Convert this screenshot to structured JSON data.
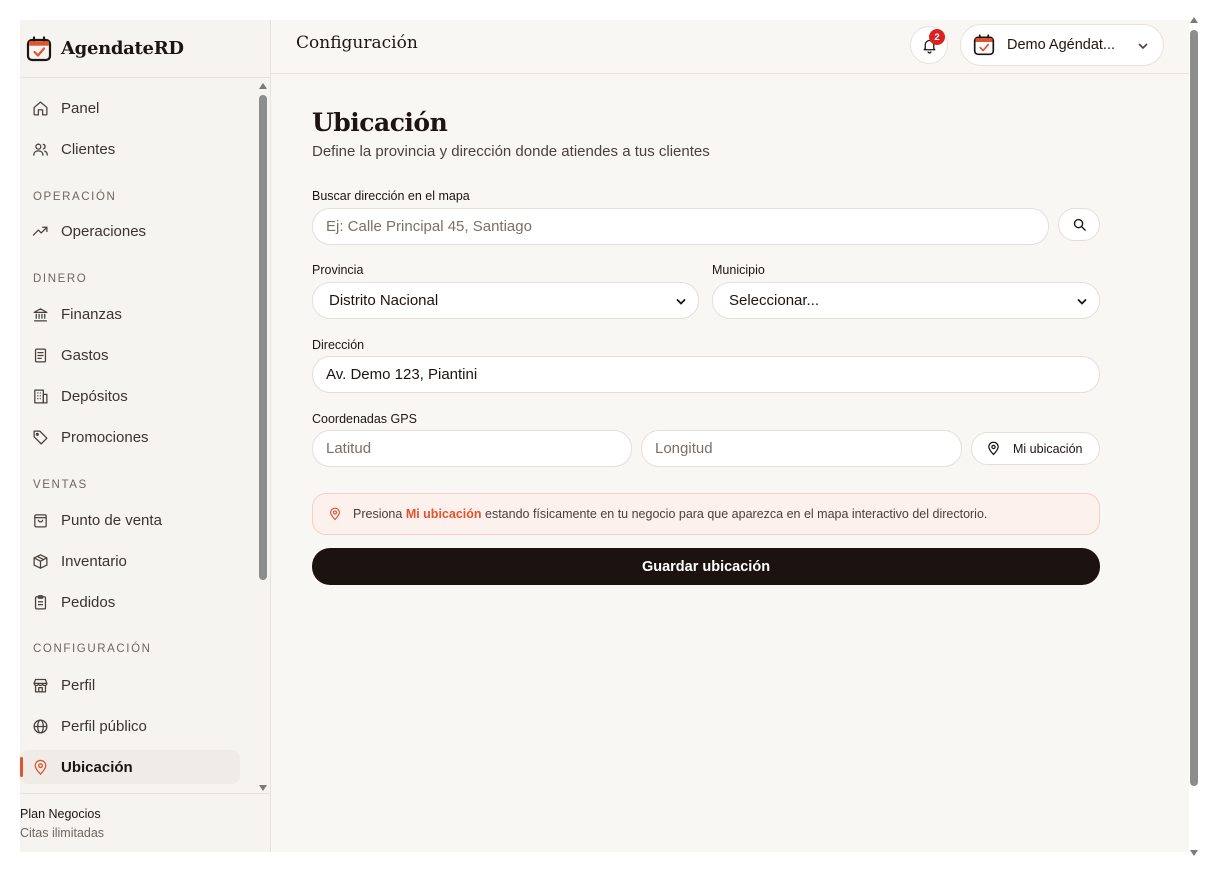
{
  "brand": {
    "name": "AgendateRD"
  },
  "sidebar": {
    "items": [
      {
        "label": "Panel",
        "icon": "home-icon"
      },
      {
        "label": "Clientes",
        "icon": "users-icon"
      },
      {
        "section": "OPERACIÓN"
      },
      {
        "label": "Operaciones",
        "icon": "trend-icon"
      },
      {
        "section": "DINERO"
      },
      {
        "label": "Finanzas",
        "icon": "bank-icon"
      },
      {
        "label": "Gastos",
        "icon": "receipt-icon"
      },
      {
        "label": "Depósitos",
        "icon": "building-icon"
      },
      {
        "label": "Promociones",
        "icon": "tag-icon"
      },
      {
        "section": "VENTAS"
      },
      {
        "label": "Punto de venta",
        "icon": "bag-icon"
      },
      {
        "label": "Inventario",
        "icon": "box-icon"
      },
      {
        "label": "Pedidos",
        "icon": "clipboard-icon"
      },
      {
        "section": "CONFIGURACIÓN"
      },
      {
        "label": "Perfil",
        "icon": "store-icon"
      },
      {
        "label": "Perfil público",
        "icon": "globe-icon"
      },
      {
        "label": "Ubicación",
        "icon": "map-pin-icon",
        "active": true
      }
    ],
    "plan": {
      "name": "Plan Negocios",
      "detail": "Citas ilimitadas"
    }
  },
  "header": {
    "title": "Configuración",
    "notifications_count": "2",
    "account_name": "Demo Agéndat..."
  },
  "main": {
    "title": "Ubicación",
    "subtitle": "Define la provincia y dirección donde atiendes a tus clientes",
    "search": {
      "label": "Buscar dirección en el mapa",
      "placeholder": "Ej: Calle Principal 45, Santiago"
    },
    "province": {
      "label": "Provincia",
      "value": "Distrito Nacional"
    },
    "municipality": {
      "label": "Municipio",
      "value": "Seleccionar..."
    },
    "address": {
      "label": "Dirección",
      "value": "Av. Demo 123, Piantini"
    },
    "gps": {
      "label": "Coordenadas GPS",
      "lat_placeholder": "Latitud",
      "lng_placeholder": "Longitud",
      "locate_label": "Mi ubicación"
    },
    "hint": {
      "prefix": "Presiona ",
      "emphasis": "Mi ubicación",
      "suffix": " estando físicamente en tu negocio para que aparezca en el mapa interactivo del directorio."
    },
    "save_label": "Guardar ubicación"
  },
  "colors": {
    "accent": "#e0532f",
    "primary_button": "#1c1310",
    "badge": "#d92323",
    "background": "#f9f7f4"
  }
}
